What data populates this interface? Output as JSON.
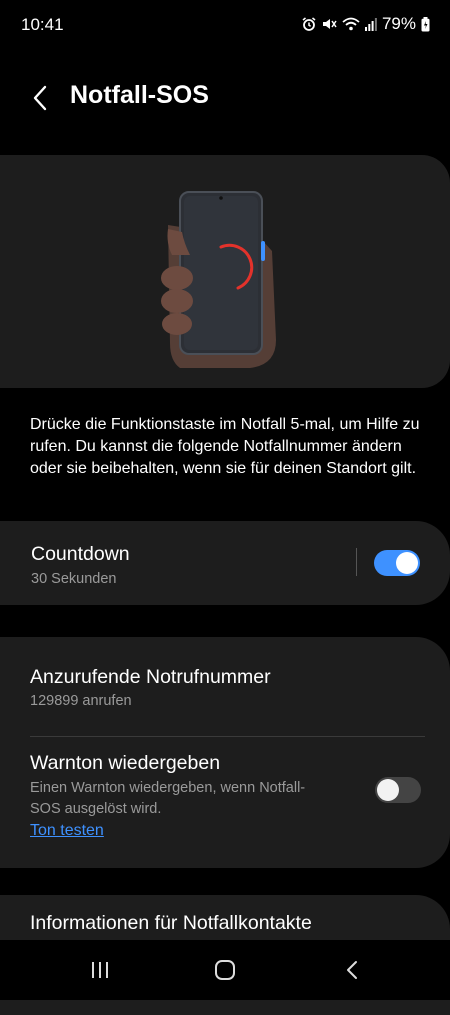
{
  "status": {
    "time": "10:41",
    "battery": "79%",
    "icons": [
      "alarm-icon",
      "mute-icon",
      "wifi-icon",
      "signal-icon",
      "battery-icon"
    ]
  },
  "header": {
    "title": "Notfall-SOS"
  },
  "description": "Drücke die Funktionstaste im Notfall 5-mal, um Hilfe zu rufen. Du kannst die folgende Notfallnummer ändern oder sie beibehalten, wenn sie für deinen Standort gilt.",
  "countdown": {
    "title": "Countdown",
    "subtitle": "30 Sekunden",
    "enabled": true
  },
  "emergency_number": {
    "title": "Anzurufende Notrufnummer",
    "subtitle": "129899 anrufen"
  },
  "warning_tone": {
    "title": "Warnton wiedergeben",
    "subtitle": "Einen Warnton wiedergeben, wenn Notfall-SOS ausgelöst wird.",
    "link": "Ton testen",
    "enabled": false
  },
  "contacts": {
    "title": "Informationen für Notfallkontakte"
  },
  "colors": {
    "accent": "#3e91ff",
    "card": "#1d1d1d",
    "background": "#000000"
  }
}
